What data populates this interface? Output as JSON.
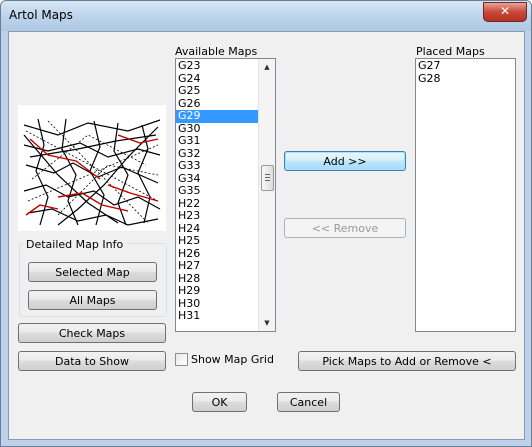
{
  "window": {
    "title": "Artol Maps",
    "close_glyph": "✕"
  },
  "available": {
    "label": "Available Maps",
    "items": [
      "G23",
      "G24",
      "G25",
      "G26",
      "G29",
      "G30",
      "G31",
      "G32",
      "G33",
      "G34",
      "G35",
      "H22",
      "H23",
      "H24",
      "H25",
      "H26",
      "H27",
      "H28",
      "H29",
      "H30",
      "H31"
    ],
    "selected": "G29"
  },
  "placed": {
    "label": "Placed Maps",
    "items": [
      "G27",
      "G28"
    ]
  },
  "buttons": {
    "add": "Add >>",
    "remove": "<< Remove",
    "selected_map": "Selected Map",
    "all_maps": "All Maps",
    "check_maps": "Check Maps",
    "data_to_show": "Data to Show",
    "pick_maps": "Pick Maps to Add or Remove <",
    "ok": "OK",
    "cancel": "Cancel"
  },
  "detail_group": {
    "label": "Detailed Map Info"
  },
  "show_grid": {
    "label": "Show Map Grid",
    "checked": false
  },
  "icons": {
    "scroll_up": "▲",
    "scroll_down": "▼",
    "map_preview": "map-preview-image"
  }
}
